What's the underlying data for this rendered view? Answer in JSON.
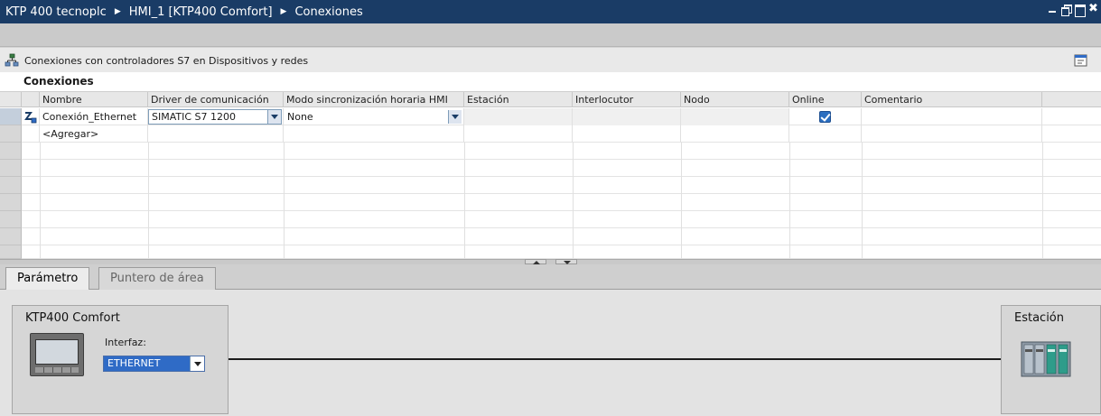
{
  "titlebar": {
    "crumbs": [
      "KTP 400 tecnoplc",
      "HMI_1 [KTP400 Comfort]",
      "Conexiones"
    ]
  },
  "infobar": {
    "text": "Conexiones con controladores S7 en Dispositivos y redes"
  },
  "grid": {
    "title": "Conexiones",
    "columns": [
      "Nombre",
      "Driver de comunicación",
      "Modo sincronización horaria HMI",
      "Estación",
      "Interlocutor",
      "Nodo",
      "Online",
      "Comentario"
    ],
    "rows": [
      {
        "name": "Conexión_Ethernet",
        "driver": "SIMATIC S7 1200",
        "sync_mode": "None",
        "station": "",
        "partner": "",
        "node": "",
        "online": true,
        "comment": ""
      }
    ],
    "add_label": "<Agregar>"
  },
  "tabs": [
    {
      "label": "Parámetro",
      "active": true
    },
    {
      "label": "Puntero de área",
      "active": false
    }
  ],
  "params": {
    "device_title": "KTP400 Comfort",
    "interface_label": "Interfaz:",
    "interface_value": "ETHERNET",
    "station_title": "Estación"
  },
  "colors": {
    "titlebar": "#1a3c66",
    "accent": "#2f6bc6"
  }
}
